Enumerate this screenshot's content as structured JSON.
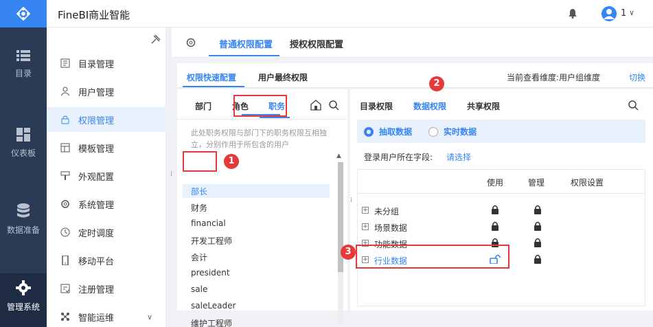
{
  "app": {
    "title": "FineBI商业智能",
    "user_label": "1",
    "user_caret": "∨"
  },
  "left_nav": [
    {
      "label": "目录",
      "icon": "list-icon"
    },
    {
      "label": "仪表板",
      "icon": "dashboard-icon"
    },
    {
      "label": "数据准备",
      "icon": "database-icon"
    },
    {
      "label": "管理系统",
      "icon": "gear-icon",
      "active": true
    }
  ],
  "menu": {
    "items": [
      {
        "label": "目录管理",
        "icon": "directory-icon"
      },
      {
        "label": "用户管理",
        "icon": "user-icon"
      },
      {
        "label": "权限管理",
        "icon": "lock-icon",
        "active": true
      },
      {
        "label": "模板管理",
        "icon": "template-icon"
      },
      {
        "label": "外观配置",
        "icon": "brush-icon"
      },
      {
        "label": "系统管理",
        "icon": "gear-icon"
      },
      {
        "label": "定时调度",
        "icon": "clock-icon"
      },
      {
        "label": "移动平台",
        "icon": "mobile-icon"
      },
      {
        "label": "注册管理",
        "icon": "register-icon"
      },
      {
        "label": "智能运维",
        "icon": "ops-icon"
      }
    ]
  },
  "top_tabs": [
    "普通权限配置",
    "授权权限配置"
  ],
  "sub_tabs": [
    "权限快速配置",
    "用户最终权限"
  ],
  "dimension": {
    "label": "当前查看维度:用户组维度",
    "switch": "切换"
  },
  "role_tabs": [
    "部门",
    "角色",
    "职务"
  ],
  "role_hint": "此处职务权限与部门下的职务权限互相独立，分别作用于所包含的用户",
  "roles": [
    "部长",
    "财务",
    "financial",
    "开发工程师",
    "会计",
    "president",
    "sale",
    "saleLeader",
    "维护工程师"
  ],
  "perm_tabs": [
    "目录权限",
    "数据权限",
    "共享权限"
  ],
  "radios": [
    "抽取数据",
    "实时数据"
  ],
  "field": {
    "label": "登录用户所在字段:",
    "link": "请选择"
  },
  "table": {
    "headers": [
      "使用",
      "管理",
      "权限设置"
    ],
    "rows": [
      {
        "label": "未分组",
        "use": "locked",
        "manage": "locked"
      },
      {
        "label": "场景数据",
        "use": "locked",
        "manage": "locked"
      },
      {
        "label": "功能数据",
        "use": "locked",
        "manage": "locked"
      },
      {
        "label": "行业数据",
        "use": "unlocked",
        "manage": "locked",
        "active": true
      }
    ]
  },
  "badges": [
    "1",
    "2",
    "3"
  ],
  "colors": {
    "accent": "#3685f2",
    "nav_bg": "#2b3a55",
    "highlight": "#e8393a"
  }
}
